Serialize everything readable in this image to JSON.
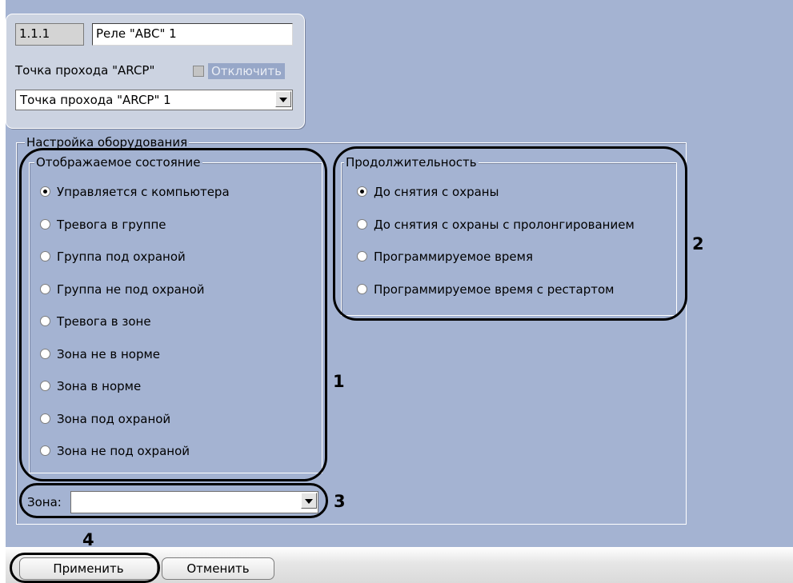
{
  "object": {
    "id": "1.1.1",
    "name": "Реле \"ABC\" 1",
    "parent_label": "Точка прохода \"ARCP\"",
    "disable_label": "Отключить",
    "parent_value": "Точка прохода \"ARCP\" 1"
  },
  "equipment": {
    "title": "Настройка оборудования",
    "state_group": {
      "title": "Отображаемое состояние",
      "options": [
        {
          "label": "Управляется с компьютера",
          "selected": true
        },
        {
          "label": "Тревога в группе",
          "selected": false
        },
        {
          "label": "Группа под охраной",
          "selected": false
        },
        {
          "label": "Группа не под охраной",
          "selected": false
        },
        {
          "label": "Тревога в зоне",
          "selected": false
        },
        {
          "label": "Зона не в норме",
          "selected": false
        },
        {
          "label": "Зона в норме",
          "selected": false
        },
        {
          "label": "Зона под охраной",
          "selected": false
        },
        {
          "label": "Зона не под охраной",
          "selected": false
        }
      ]
    },
    "duration_group": {
      "title": "Продолжительность",
      "options": [
        {
          "label": "До снятия с охраны",
          "selected": true
        },
        {
          "label": "До снятия с охраны с пролонгированием",
          "selected": false
        },
        {
          "label": "Программируемое время",
          "selected": false
        },
        {
          "label": "Программируемое время с рестартом",
          "selected": false
        }
      ]
    },
    "zone_label": "Зона:",
    "zone_value": ""
  },
  "buttons": {
    "apply": "Применить",
    "cancel": "Отменить"
  },
  "markers": [
    "1",
    "2",
    "3",
    "4"
  ]
}
